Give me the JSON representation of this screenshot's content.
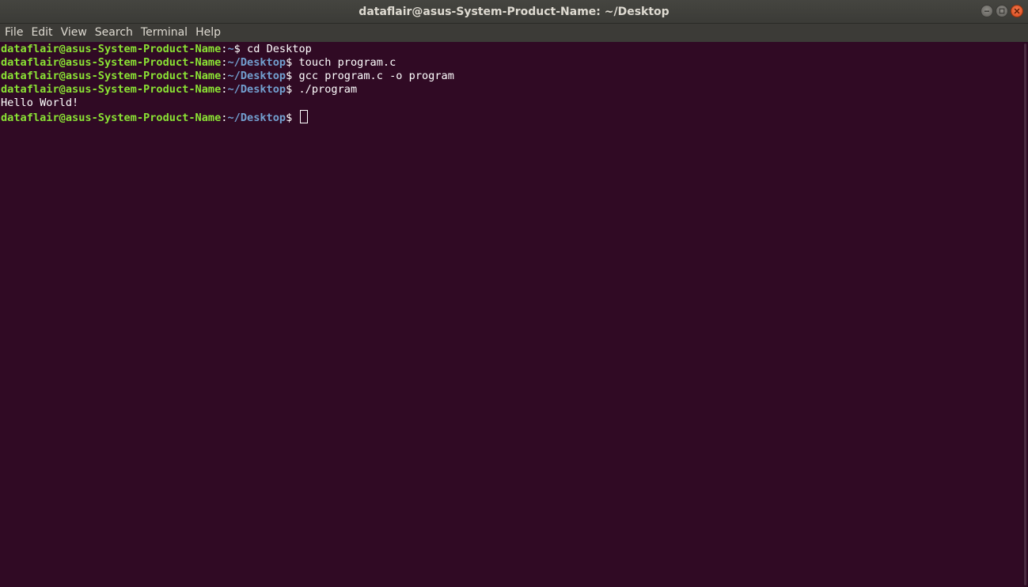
{
  "window": {
    "title": "dataflair@asus-System-Product-Name: ~/Desktop"
  },
  "menu": [
    "File",
    "Edit",
    "View",
    "Search",
    "Terminal",
    "Help"
  ],
  "terminal": {
    "lines": [
      {
        "user": "dataflair@asus-System-Product-Name",
        "sep": ":",
        "path": "~",
        "prompt": "$ ",
        "command": "cd Desktop"
      },
      {
        "user": "dataflair@asus-System-Product-Name",
        "sep": ":",
        "path": "~/Desktop",
        "prompt": "$ ",
        "command": "touch program.c"
      },
      {
        "user": "dataflair@asus-System-Product-Name",
        "sep": ":",
        "path": "~/Desktop",
        "prompt": "$ ",
        "command": "gcc program.c -o program"
      },
      {
        "user": "dataflair@asus-System-Product-Name",
        "sep": ":",
        "path": "~/Desktop",
        "prompt": "$ ",
        "command": "./program"
      },
      {
        "output": "Hello World!"
      },
      {
        "user": "dataflair@asus-System-Product-Name",
        "sep": ":",
        "path": "~/Desktop",
        "prompt": "$ ",
        "command": ""
      }
    ]
  },
  "colors": {
    "background": "#300a24",
    "user": "#8ae234",
    "path": "#729fcf",
    "text": "#ffffff"
  },
  "icons": {
    "minimize": "minimize-icon",
    "maximize": "maximize-icon",
    "close": "close-icon"
  }
}
